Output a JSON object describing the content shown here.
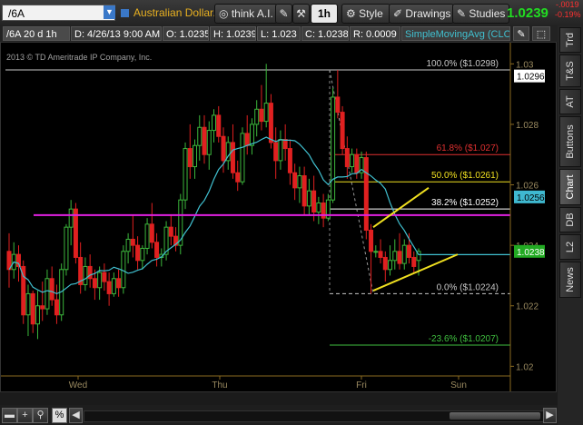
{
  "toolbar": {
    "symbol": "/6A",
    "description": "Australian Dollar...",
    "think": "think A.I.",
    "interval": "1h",
    "style": "Style",
    "drawings": "Drawings",
    "studies": "Studies",
    "last_price": "1.0239",
    "change": "-.0019",
    "change_pct": "-0.19%"
  },
  "header": {
    "symbol_tf": "/6A 20 d 1h",
    "date": "D: 4/26/13 9:00 AM",
    "open": "O: 1.0235",
    "high": "H: 1.0239",
    "low": "L: 1.023",
    "close": "C: 1.0238",
    "range": "R: 0.0009",
    "study": "SimpleMovingAvg (CLO..."
  },
  "chart": {
    "copyright": "2013 © TD Ameritrade IP Company, Inc.",
    "price_ticks": [
      "1.03",
      "1.028",
      "1.026",
      "1.024",
      "1.022",
      "1.02"
    ],
    "date_labels": [
      "Wed",
      "Thu",
      "Fri",
      "Sun"
    ],
    "fib_levels": [
      {
        "label": "100.0%  ($1.0298)",
        "color": "#c8c8c8"
      },
      {
        "label": "61.8%  ($1.027)",
        "color": "#e03030"
      },
      {
        "label": "50.0%  ($1.0261)",
        "color": "#f0e020"
      },
      {
        "label": "38.2%  ($1.0252)",
        "color": "#ffffff"
      },
      {
        "label": "0.0%  ($1.0224)",
        "color": "#c8c8c8"
      },
      {
        "label": "-23.6%  ($1.0207)",
        "color": "#40c040"
      }
    ],
    "price_badges": [
      {
        "value": "1.0296",
        "color": "#ffffff",
        "text_color": "#000"
      },
      {
        "value": "1.0256",
        "color": "#3fb9d0",
        "text_color": "#000"
      },
      {
        "value": "1.0238",
        "color": "#22aa22",
        "text_color": "#fff"
      }
    ],
    "colors": {
      "up": "#3cb73c",
      "down": "#e02020",
      "sma": "#40c0d0",
      "magenta": "#e020e0",
      "trendline": "#f0e020"
    },
    "candles": [
      {
        "o": 1.0238,
        "h": 1.0244,
        "l": 1.0226,
        "c": 1.0232
      },
      {
        "o": 1.0232,
        "h": 1.0241,
        "l": 1.0229,
        "c": 1.0237
      },
      {
        "o": 1.0237,
        "h": 1.024,
        "l": 1.0228,
        "c": 1.0233
      },
      {
        "o": 1.0233,
        "h": 1.0235,
        "l": 1.0214,
        "c": 1.0217
      },
      {
        "o": 1.0217,
        "h": 1.0227,
        "l": 1.021,
        "c": 1.0224
      },
      {
        "o": 1.0224,
        "h": 1.0225,
        "l": 1.0211,
        "c": 1.0214
      },
      {
        "o": 1.0214,
        "h": 1.0225,
        "l": 1.0209,
        "c": 1.022
      },
      {
        "o": 1.022,
        "h": 1.0228,
        "l": 1.0215,
        "c": 1.0219
      },
      {
        "o": 1.0219,
        "h": 1.0232,
        "l": 1.0217,
        "c": 1.0229
      },
      {
        "o": 1.0229,
        "h": 1.0233,
        "l": 1.022,
        "c": 1.0222
      },
      {
        "o": 1.0222,
        "h": 1.0227,
        "l": 1.0214,
        "c": 1.0217
      },
      {
        "o": 1.0217,
        "h": 1.0234,
        "l": 1.0215,
        "c": 1.0232
      },
      {
        "o": 1.0232,
        "h": 1.0247,
        "l": 1.023,
        "c": 1.0246
      },
      {
        "o": 1.0246,
        "h": 1.0255,
        "l": 1.024,
        "c": 1.0252
      },
      {
        "o": 1.0252,
        "h": 1.0254,
        "l": 1.0234,
        "c": 1.0236
      },
      {
        "o": 1.0236,
        "h": 1.0241,
        "l": 1.0224,
        "c": 1.0227
      },
      {
        "o": 1.0227,
        "h": 1.0236,
        "l": 1.0225,
        "c": 1.0233
      },
      {
        "o": 1.0233,
        "h": 1.0237,
        "l": 1.0226,
        "c": 1.0229
      },
      {
        "o": 1.0229,
        "h": 1.0232,
        "l": 1.0222,
        "c": 1.0226
      },
      {
        "o": 1.0226,
        "h": 1.0233,
        "l": 1.0222,
        "c": 1.0231
      },
      {
        "o": 1.0231,
        "h": 1.0234,
        "l": 1.0225,
        "c": 1.0228
      },
      {
        "o": 1.0228,
        "h": 1.0231,
        "l": 1.022,
        "c": 1.0224
      },
      {
        "o": 1.0224,
        "h": 1.0231,
        "l": 1.0223,
        "c": 1.0229
      },
      {
        "o": 1.0229,
        "h": 1.0232,
        "l": 1.0223,
        "c": 1.0226
      },
      {
        "o": 1.0226,
        "h": 1.024,
        "l": 1.0224,
        "c": 1.0238
      },
      {
        "o": 1.0238,
        "h": 1.0244,
        "l": 1.0234,
        "c": 1.0242
      },
      {
        "o": 1.0242,
        "h": 1.025,
        "l": 1.0236,
        "c": 1.024
      },
      {
        "o": 1.024,
        "h": 1.0243,
        "l": 1.0232,
        "c": 1.0235
      },
      {
        "o": 1.0235,
        "h": 1.024,
        "l": 1.0232,
        "c": 1.0239
      },
      {
        "o": 1.0239,
        "h": 1.0249,
        "l": 1.0237,
        "c": 1.0247
      },
      {
        "o": 1.0247,
        "h": 1.0254,
        "l": 1.0239,
        "c": 1.0241
      },
      {
        "o": 1.0241,
        "h": 1.0244,
        "l": 1.0233,
        "c": 1.0236
      },
      {
        "o": 1.0236,
        "h": 1.0239,
        "l": 1.0233,
        "c": 1.0237
      },
      {
        "o": 1.0237,
        "h": 1.0248,
        "l": 1.0235,
        "c": 1.0246
      },
      {
        "o": 1.0246,
        "h": 1.025,
        "l": 1.024,
        "c": 1.0243
      },
      {
        "o": 1.0243,
        "h": 1.0246,
        "l": 1.0238,
        "c": 1.024
      },
      {
        "o": 1.024,
        "h": 1.0257,
        "l": 1.0237,
        "c": 1.0255
      },
      {
        "o": 1.0255,
        "h": 1.0274,
        "l": 1.0252,
        "c": 1.0272
      },
      {
        "o": 1.0272,
        "h": 1.028,
        "l": 1.0262,
        "c": 1.0266
      },
      {
        "o": 1.0266,
        "h": 1.0275,
        "l": 1.0262,
        "c": 1.0273
      },
      {
        "o": 1.0273,
        "h": 1.0283,
        "l": 1.0268,
        "c": 1.0279
      },
      {
        "o": 1.0279,
        "h": 1.0283,
        "l": 1.0267,
        "c": 1.027
      },
      {
        "o": 1.027,
        "h": 1.0281,
        "l": 1.0265,
        "c": 1.0278
      },
      {
        "o": 1.0278,
        "h": 1.0285,
        "l": 1.0274,
        "c": 1.0283
      },
      {
        "o": 1.0283,
        "h": 1.0286,
        "l": 1.0274,
        "c": 1.0276
      },
      {
        "o": 1.0276,
        "h": 1.0279,
        "l": 1.0264,
        "c": 1.0268
      },
      {
        "o": 1.0268,
        "h": 1.0276,
        "l": 1.0265,
        "c": 1.0274
      },
      {
        "o": 1.0274,
        "h": 1.028,
        "l": 1.0262,
        "c": 1.0264
      },
      {
        "o": 1.0264,
        "h": 1.0268,
        "l": 1.0258,
        "c": 1.0261
      },
      {
        "o": 1.0261,
        "h": 1.0279,
        "l": 1.026,
        "c": 1.0277
      },
      {
        "o": 1.0277,
        "h": 1.0283,
        "l": 1.027,
        "c": 1.0273
      },
      {
        "o": 1.0273,
        "h": 1.0282,
        "l": 1.027,
        "c": 1.028
      },
      {
        "o": 1.028,
        "h": 1.0288,
        "l": 1.0276,
        "c": 1.0285
      },
      {
        "o": 1.0285,
        "h": 1.0293,
        "l": 1.0278,
        "c": 1.0281
      },
      {
        "o": 1.0281,
        "h": 1.03,
        "l": 1.0279,
        "c": 1.0287
      },
      {
        "o": 1.0287,
        "h": 1.029,
        "l": 1.0272,
        "c": 1.0274
      },
      {
        "o": 1.0274,
        "h": 1.0279,
        "l": 1.0262,
        "c": 1.0268
      },
      {
        "o": 1.0268,
        "h": 1.0278,
        "l": 1.0265,
        "c": 1.0275
      },
      {
        "o": 1.0275,
        "h": 1.028,
        "l": 1.0268,
        "c": 1.0272
      },
      {
        "o": 1.0272,
        "h": 1.0275,
        "l": 1.026,
        "c": 1.0264
      },
      {
        "o": 1.0264,
        "h": 1.0267,
        "l": 1.0255,
        "c": 1.0259
      },
      {
        "o": 1.0259,
        "h": 1.0266,
        "l": 1.0254,
        "c": 1.0263
      },
      {
        "o": 1.0263,
        "h": 1.0266,
        "l": 1.025,
        "c": 1.0253
      },
      {
        "o": 1.0253,
        "h": 1.0262,
        "l": 1.025,
        "c": 1.0258
      },
      {
        "o": 1.0258,
        "h": 1.0263,
        "l": 1.0248,
        "c": 1.0251
      },
      {
        "o": 1.0251,
        "h": 1.0256,
        "l": 1.0247,
        "c": 1.0254
      },
      {
        "o": 1.0254,
        "h": 1.0257,
        "l": 1.0246,
        "c": 1.0249
      },
      {
        "o": 1.0249,
        "h": 1.0257,
        "l": 1.0248,
        "c": 1.0255
      },
      {
        "o": 1.0255,
        "h": 1.0292,
        "l": 1.0254,
        "c": 1.0289
      },
      {
        "o": 1.0289,
        "h": 1.0298,
        "l": 1.0282,
        "c": 1.0284
      },
      {
        "o": 1.0284,
        "h": 1.0286,
        "l": 1.027,
        "c": 1.0272
      },
      {
        "o": 1.0272,
        "h": 1.0276,
        "l": 1.0262,
        "c": 1.0266
      },
      {
        "o": 1.0266,
        "h": 1.0272,
        "l": 1.0264,
        "c": 1.027
      },
      {
        "o": 1.027,
        "h": 1.0272,
        "l": 1.0262,
        "c": 1.0264
      },
      {
        "o": 1.0264,
        "h": 1.0271,
        "l": 1.0262,
        "c": 1.0269
      },
      {
        "o": 1.0269,
        "h": 1.0271,
        "l": 1.0242,
        "c": 1.0245
      },
      {
        "o": 1.0245,
        "h": 1.0247,
        "l": 1.0224,
        "c": 1.0238
      },
      {
        "o": 1.0238,
        "h": 1.024,
        "l": 1.0236,
        "c": 1.0238
      },
      {
        "o": 1.0238,
        "h": 1.0242,
        "l": 1.0234,
        "c": 1.0236
      },
      {
        "o": 1.0236,
        "h": 1.0238,
        "l": 1.0228,
        "c": 1.0232
      },
      {
        "o": 1.0232,
        "h": 1.024,
        "l": 1.023,
        "c": 1.0235
      },
      {
        "o": 1.0235,
        "h": 1.0242,
        "l": 1.0232,
        "c": 1.0238
      },
      {
        "o": 1.0238,
        "h": 1.0244,
        "l": 1.0232,
        "c": 1.0234
      },
      {
        "o": 1.0234,
        "h": 1.0242,
        "l": 1.0232,
        "c": 1.024
      },
      {
        "o": 1.024,
        "h": 1.0244,
        "l": 1.0234,
        "c": 1.0236
      },
      {
        "o": 1.0236,
        "h": 1.0238,
        "l": 1.0231,
        "c": 1.0233
      },
      {
        "o": 1.0235,
        "h": 1.0239,
        "l": 1.023,
        "c": 1.0238
      }
    ]
  },
  "right_tabs": [
    "Trd",
    "T&S",
    "AT",
    "Buttons",
    "Chart",
    "DB",
    "L2",
    "News"
  ],
  "active_tab": "Chart"
}
